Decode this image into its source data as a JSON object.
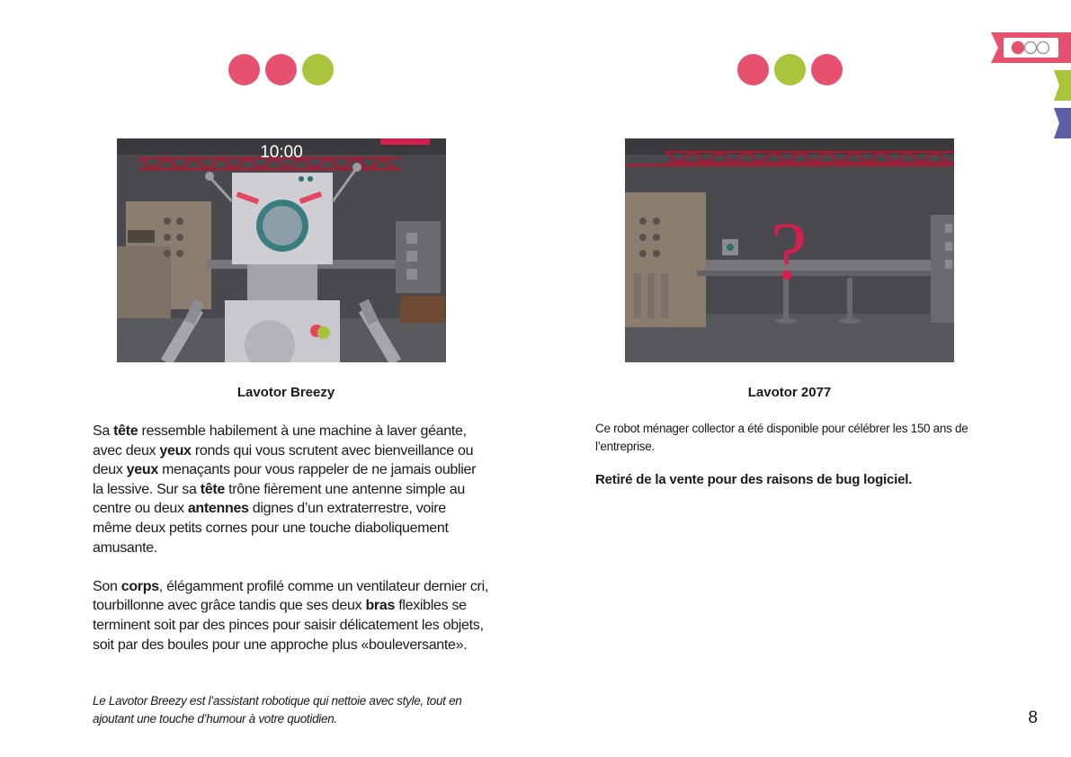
{
  "colors": {
    "pink": "#e6516f",
    "green": "#a7c43a",
    "purple": "#5b5fa6",
    "crimson": "#d21f4e"
  },
  "left": {
    "dots": [
      "pink",
      "pink",
      "green"
    ],
    "timer": "10:00",
    "caption": "Lavotor Breezy",
    "paragraph1": [
      {
        "text": "Sa ",
        "bold": false
      },
      {
        "text": "tête",
        "bold": true
      },
      {
        "text": " ressemble habilement à une machine à laver géante, avec deux ",
        "bold": false
      },
      {
        "text": "yeux",
        "bold": true
      },
      {
        "text": " ronds qui vous scrutent avec bienveillance ou deux ",
        "bold": false
      },
      {
        "text": "yeux",
        "bold": true
      },
      {
        "text": " menaçants pour vous rappeler de ne jamais oublier la lessive. Sur sa ",
        "bold": false
      },
      {
        "text": "tête",
        "bold": true
      },
      {
        "text": " trône fièrement une antenne simple au centre ou deux ",
        "bold": false
      },
      {
        "text": "antennes",
        "bold": true
      },
      {
        "text": " dignes d’un extraterrestre, voire même deux petits cornes pour une touche diaboliquement amusante.",
        "bold": false
      }
    ],
    "paragraph2": [
      {
        "text": "Son ",
        "bold": false
      },
      {
        "text": "corps",
        "bold": true
      },
      {
        "text": ", élégamment profilé comme un ventilateur dernier cri, tourbillonne avec grâce tandis que ses deux ",
        "bold": false
      },
      {
        "text": "bras",
        "bold": true
      },
      {
        "text": " flexibles se terminent soit par des pinces pour saisir délicatement les objets, soit par des boules pour une approche plus «bouleversante».",
        "bold": false
      }
    ],
    "note": "Le Lavotor Breezy est l’assistant robotique qui nettoie avec style, tout en ajoutant une touche d’humour à votre quotidien."
  },
  "right": {
    "dots": [
      "pink",
      "green",
      "pink"
    ],
    "question_mark": "?",
    "caption": "Lavotor 2077",
    "description": "Ce robot ménager collector a été disponible pour célébrer les 150 ans de l’entreprise.",
    "withdrawn": "Retiré de la vente pour des raisons de bug logiciel."
  },
  "page_number": "8"
}
